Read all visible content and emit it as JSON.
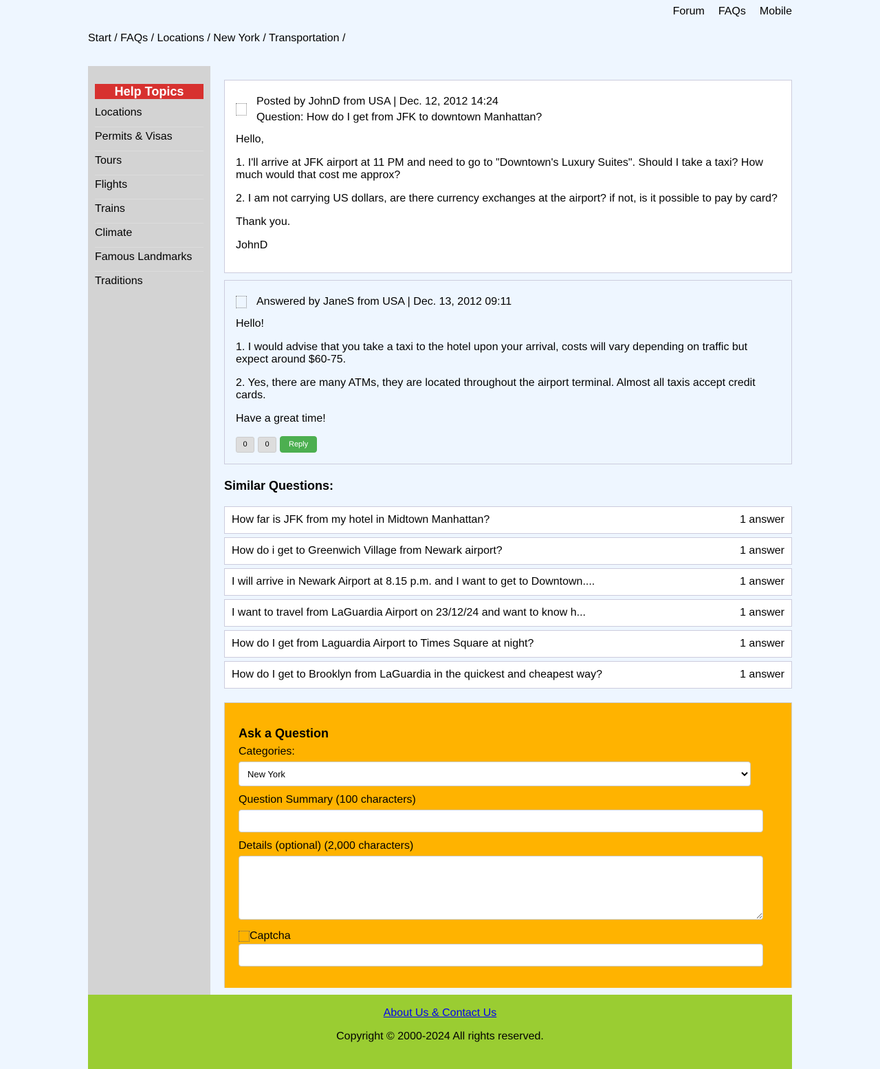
{
  "topnav": {
    "forum": "Forum",
    "faqs": "FAQs",
    "mobile": "Mobile"
  },
  "breadcrumb": "Start / FAQs / Locations / New York / Transportation /",
  "sidebar": {
    "title": "Help Topics",
    "items": [
      {
        "label": "Locations"
      },
      {
        "label": "Permits & Visas"
      },
      {
        "label": "Tours"
      },
      {
        "label": "Flights"
      },
      {
        "label": "Trains"
      },
      {
        "label": "Climate"
      },
      {
        "label": "Famous Landmarks"
      },
      {
        "label": "Traditions"
      }
    ]
  },
  "question": {
    "meta": "Posted by JohnD from USA | Dec. 12, 2012 14:24",
    "title": "Question: How do I get from JFK to downtown Manhattan?",
    "paragraphs": [
      "Hello,",
      "1. I'll arrive at JFK airport at 11 PM and need to go to \"Downtown's Luxury Suites\". Should I take a taxi? How much would that cost me approx?",
      "2. I am not carrying US dollars, are there currency exchanges at the airport? if not, is it possible to pay by card?",
      "Thank you.",
      "JohnD"
    ]
  },
  "answer": {
    "meta": "Answered by JaneS from USA | Dec. 13, 2012 09:11",
    "paragraphs": [
      "Hello!",
      "1. I would advise that you take a taxi to the hotel upon your arrival, costs will vary depending on traffic but expect around $60-75.",
      "2. Yes, there are many ATMs, they are located throughout the airport terminal. Almost all taxis accept credit cards.",
      "Have a great time!"
    ],
    "upvotes": "0",
    "downvotes": "0",
    "reply_label": "Reply"
  },
  "similar": {
    "title": "Similar Questions:",
    "items": [
      {
        "question": "How far is JFK from my hotel in Midtown Manhattan?",
        "answers": "1 answer"
      },
      {
        "question": "How do i get to Greenwich Village from Newark airport?",
        "answers": "1 answer"
      },
      {
        "question": "I will arrive in Newark Airport at 8.15 p.m. and I want to get to Downtown....",
        "answers": "1 answer"
      },
      {
        "question": "I want to travel from LaGuardia Airport on 23/12/24 and want to know h...",
        "answers": "1 answer"
      },
      {
        "question": "How do I get from Laguardia Airport to Times Square at night?",
        "answers": "1 answer"
      },
      {
        "question": "How do I get to Brooklyn from LaGuardia in the quickest and cheapest way?",
        "answers": "1 answer"
      }
    ]
  },
  "ask": {
    "title": "Ask a Question",
    "categories_label": "Categories:",
    "category_selected": "New York",
    "summary_label": "Question Summary (100 characters)",
    "summary_value": "",
    "details_label": "Details (optional) (2,000 characters)",
    "details_value": "",
    "captcha_alt": "Captcha",
    "captcha_value": ""
  },
  "footer": {
    "link": "About Us & Contact Us",
    "copyright": "Copyright © 2000-2024 All rights reserved."
  },
  "colors": {
    "page_bg": "#eef6ff",
    "sidebar_bg": "#d3d3d3",
    "help_title_bg": "#d7312f",
    "reply_button": "#4caf50",
    "ask_bg": "#ffb300",
    "footer_bg": "#9acd32"
  }
}
